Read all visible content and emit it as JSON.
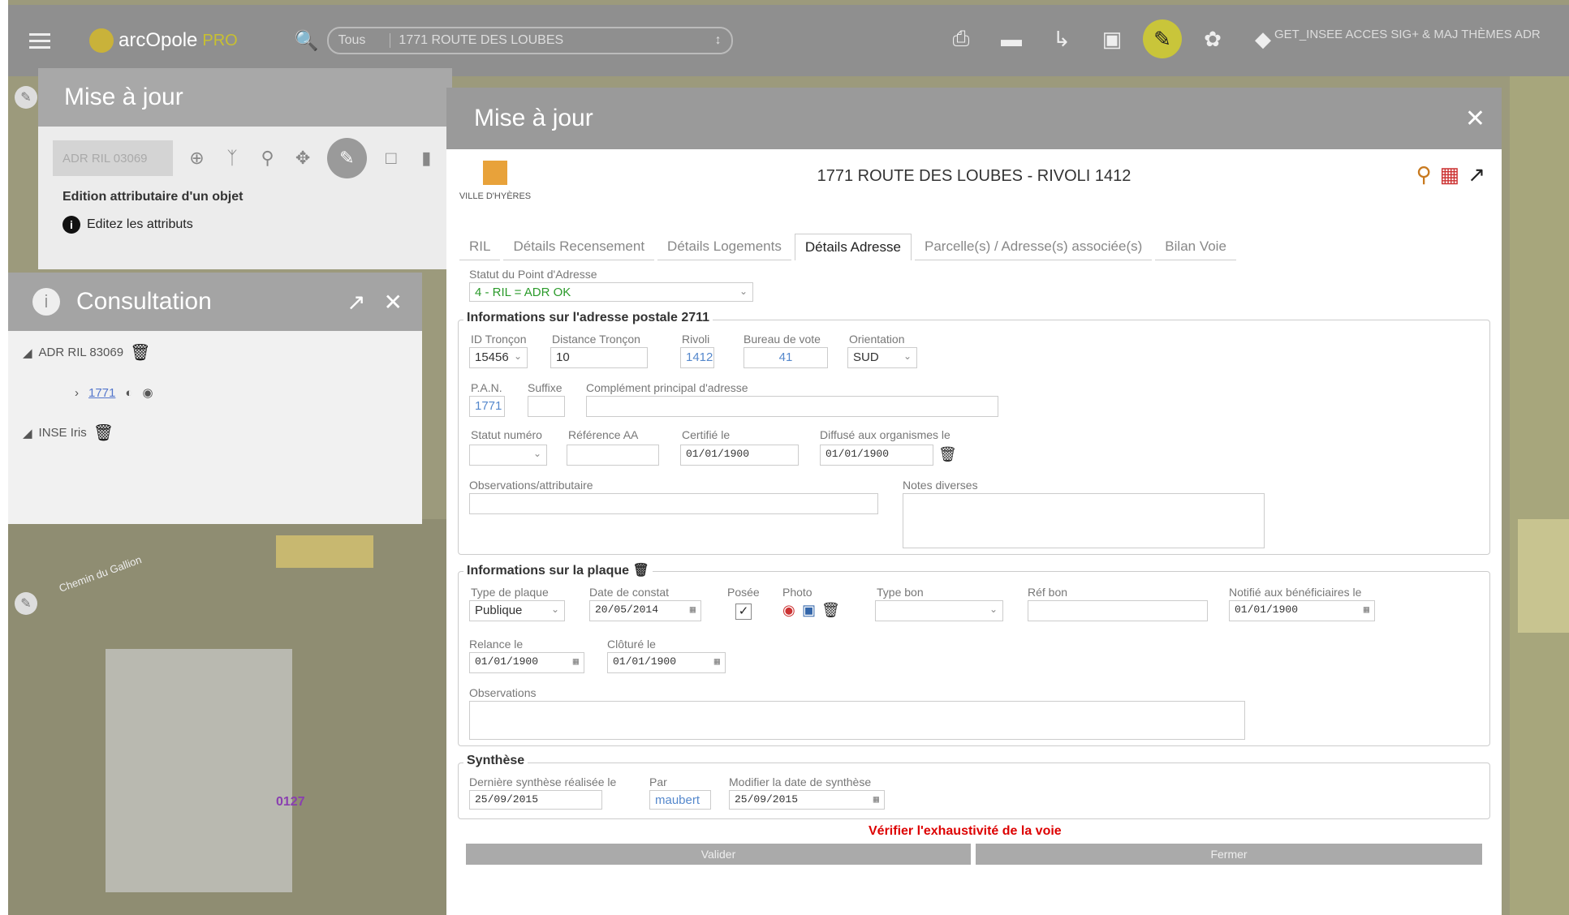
{
  "app": {
    "name": "arcOpole",
    "name_suffix": "PRO"
  },
  "search": {
    "type": "Tous",
    "value": "1771 ROUTE DES LOUBES"
  },
  "toolbar": {
    "icons": [
      "print-icon",
      "measure-icon",
      "share-icon",
      "layers-icon",
      "edit-icon",
      "palette-icon",
      "basemap-icon"
    ],
    "links_text": "GET_INSEE ACCES SIG+ & MAJ THÈMES ADR"
  },
  "edit_panel": {
    "title": "Mise à jour",
    "field_value": "ADR RIL 03069",
    "section_title": "Edition attributaire d'un objet",
    "hint": "Editez les attributs"
  },
  "consultation": {
    "title": "Consultation",
    "tree": [
      {
        "label": "ADR RIL 83069"
      },
      {
        "label": "1771"
      },
      {
        "label": "INSE Iris"
      }
    ]
  },
  "map": {
    "parcel_label": "0127",
    "road_label": "Chemin du Gallion"
  },
  "modal": {
    "title": "Mise à jour",
    "logo_text": "VILLE D'HYÈRES",
    "heading": "1771 ROUTE DES LOUBES - RIVOLI 1412",
    "tabs": [
      "RIL",
      "Détails Recensement",
      "Détails Logements",
      "Détails Adresse",
      "Parcelle(s) / Adresse(s) associée(s)",
      "Bilan Voie"
    ],
    "active_tab": "Détails Adresse",
    "status": {
      "label": "Statut du Point d'Adresse",
      "value": "4 - RIL = ADR OK"
    },
    "postal": {
      "legend": "Informations sur l'adresse postale 2711",
      "id_troncon": {
        "label": "ID Tronçon",
        "value": "15456"
      },
      "distance": {
        "label": "Distance Tronçon",
        "value": "10"
      },
      "rivoli": {
        "label": "Rivoli",
        "value": "1412"
      },
      "bureau": {
        "label": "Bureau de vote",
        "value": "41"
      },
      "orientation": {
        "label": "Orientation",
        "value": "SUD"
      },
      "pan": {
        "label": "P.A.N.",
        "value": "1771"
      },
      "suffixe": {
        "label": "Suffixe",
        "value": ""
      },
      "complement": {
        "label": "Complément principal d'adresse",
        "value": ""
      },
      "statut_num": {
        "label": "Statut numéro",
        "value": ""
      },
      "ref_aa": {
        "label": "Référence AA",
        "value": ""
      },
      "certifie": {
        "label": "Certifié le",
        "value": "01/01/1900"
      },
      "diffuse": {
        "label": "Diffusé aux organismes le",
        "value": "01/01/1900"
      },
      "observations": {
        "label": "Observations/attributaire",
        "value": ""
      },
      "notes": {
        "label": "Notes diverses",
        "value": ""
      }
    },
    "plaque": {
      "legend": "Informations sur la plaque",
      "type": {
        "label": "Type de plaque",
        "value": "Publique"
      },
      "date_constat": {
        "label": "Date de constat",
        "value": "20/05/2014"
      },
      "posee": {
        "label": "Posée",
        "checked": true
      },
      "photo": {
        "label": "Photo"
      },
      "type_bon": {
        "label": "Type bon",
        "value": ""
      },
      "ref_bon": {
        "label": "Réf bon",
        "value": ""
      },
      "notifie": {
        "label": "Notifié aux bénéficiaires le",
        "value": "01/01/1900"
      },
      "relance": {
        "label": "Relance le",
        "value": "01/01/1900"
      },
      "cloture": {
        "label": "Clôturé le",
        "value": "01/01/1900"
      },
      "observations": {
        "label": "Observations",
        "value": ""
      }
    },
    "synthese": {
      "legend": "Synthèse",
      "derniere": {
        "label": "Dernière synthèse réalisée le",
        "value": "25/09/2015"
      },
      "par": {
        "label": "Par",
        "value": "maubert"
      },
      "modifier": {
        "label": "Modifier la date de synthèse",
        "value": "25/09/2015"
      }
    },
    "warning": "Vérifier l'exhaustivité de la voie",
    "buttons": {
      "validate": "Valider",
      "close": "Fermer"
    }
  }
}
